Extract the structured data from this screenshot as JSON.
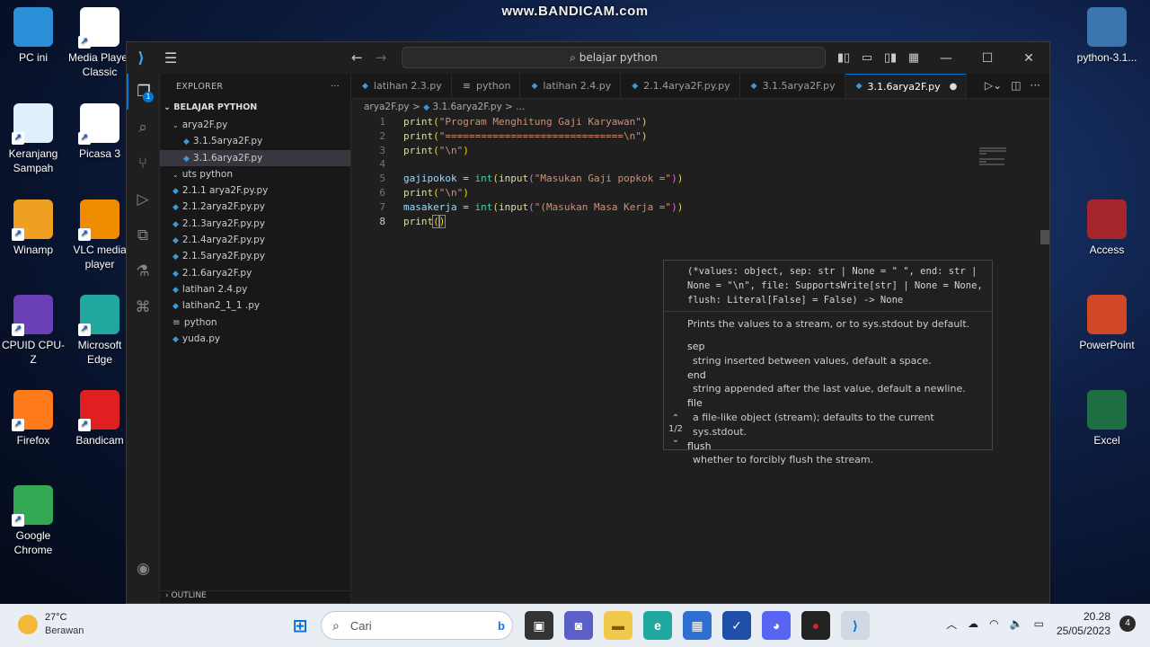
{
  "watermark": "www.BANDICAM.com",
  "desktop": {
    "left_icons": [
      {
        "label": "PC ini",
        "icon": "monitor-icon",
        "color": "#2b8fd8"
      },
      {
        "label": "Media Player Classic",
        "icon": "media-player-icon",
        "color": "#ffffff"
      },
      {
        "label": "Keranjang Sampah",
        "icon": "recycle-bin-icon",
        "color": "#e0f0ff"
      },
      {
        "label": "Picasa 3",
        "icon": "picasa-icon",
        "color": "#ffffff"
      },
      {
        "label": "Winamp",
        "icon": "winamp-icon",
        "color": "#f0a020"
      },
      {
        "label": "VLC media player",
        "icon": "vlc-icon",
        "color": "#f08c00"
      },
      {
        "label": "CPUID CPU-Z",
        "icon": "cpuz-icon",
        "color": "#6a3fb5"
      },
      {
        "label": "Microsoft Edge",
        "icon": "edge-icon",
        "color": "#1fa7a0"
      },
      {
        "label": "Firefox",
        "icon": "firefox-icon",
        "color": "#ff7a1a"
      },
      {
        "label": "Bandicam",
        "icon": "bandicam-icon",
        "color": "#e02020"
      },
      {
        "label": "Google Chrome",
        "icon": "chrome-icon",
        "color": "#34a853"
      }
    ],
    "right_icons": [
      {
        "label": "python-3.1...",
        "icon": "python-installer-icon",
        "color": "#3a75b0"
      },
      {
        "label": "Access",
        "icon": "access-icon",
        "color": "#a4262c"
      },
      {
        "label": "PowerPoint",
        "icon": "powerpoint-icon",
        "color": "#d24726"
      },
      {
        "label": "Excel",
        "icon": "excel-icon",
        "color": "#1d6f42"
      }
    ]
  },
  "vscode": {
    "command_center": "belajar python",
    "explorer_title": "EXPLORER",
    "explorer_more": "···",
    "workspace": "BELAJAR PYTHON",
    "tree": [
      {
        "label": "arya2F.py",
        "type": "folder",
        "indent": 1
      },
      {
        "label": "3.1.5arya2F.py",
        "type": "py",
        "indent": 2
      },
      {
        "label": "3.1.6arya2F.py",
        "type": "py",
        "indent": 2,
        "selected": true
      },
      {
        "label": "uts python",
        "type": "folder",
        "indent": 1
      },
      {
        "label": "2.1.1 arya2F.py.py",
        "type": "py",
        "indent": 1
      },
      {
        "label": "2.1.2arya2F.py.py",
        "type": "py",
        "indent": 1
      },
      {
        "label": "2.1.3arya2F.py.py",
        "type": "py",
        "indent": 1
      },
      {
        "label": "2.1.4arya2F.py.py",
        "type": "py",
        "indent": 1
      },
      {
        "label": "2.1.5arya2F.py.py",
        "type": "py",
        "indent": 1
      },
      {
        "label": "2.1.6arya2F.py",
        "type": "py",
        "indent": 1
      },
      {
        "label": "latihan 2.4.py",
        "type": "py",
        "indent": 1
      },
      {
        "label": "latihan2_1_1 .py",
        "type": "py",
        "indent": 1
      },
      {
        "label": "python",
        "type": "text",
        "indent": 1
      },
      {
        "label": "yuda.py",
        "type": "py",
        "indent": 1
      }
    ],
    "outline_label": "OUTLINE",
    "tabs": [
      {
        "label": "latihan 2.3.py",
        "type": "py"
      },
      {
        "label": "python",
        "type": "text"
      },
      {
        "label": "latihan 2.4.py",
        "type": "py"
      },
      {
        "label": "2.1.4arya2F.py.py",
        "type": "py"
      },
      {
        "label": "3.1.5arya2F.py",
        "type": "py"
      },
      {
        "label": "3.1.6arya2F.py",
        "type": "py",
        "active": true,
        "dirty": true
      }
    ],
    "breadcrumb": {
      "folder": "arya2F.py",
      "sep": ">",
      "file": "3.1.6arya2F.py",
      "rest": "> ..."
    },
    "code_lines": [
      {
        "n": "1",
        "parts": [
          [
            "fn",
            "print"
          ],
          [
            "br1",
            "("
          ],
          [
            "str",
            "\"Program Menghitung Gaji Karyawan\""
          ],
          [
            "br1",
            ")"
          ]
        ]
      },
      {
        "n": "2",
        "parts": [
          [
            "fn",
            "print"
          ],
          [
            "br1",
            "("
          ],
          [
            "str",
            "\"==============================\\n\""
          ],
          [
            "br1",
            ")"
          ]
        ]
      },
      {
        "n": "3",
        "parts": [
          [
            "fn",
            "print"
          ],
          [
            "br1",
            "("
          ],
          [
            "str",
            "\"\\n\""
          ],
          [
            "br1",
            ")"
          ]
        ]
      },
      {
        "n": "4",
        "parts": []
      },
      {
        "n": "5",
        "parts": [
          [
            "var",
            "gajipokok"
          ],
          [
            "op",
            " = "
          ],
          [
            "cls",
            "int"
          ],
          [
            "br1",
            "("
          ],
          [
            "fn",
            "input"
          ],
          [
            "br2",
            "("
          ],
          [
            "str",
            "\"Masukan Gaji popkok =\""
          ],
          [
            "br2",
            ")"
          ],
          [
            "br1",
            ")"
          ]
        ]
      },
      {
        "n": "6",
        "parts": [
          [
            "fn",
            "print"
          ],
          [
            "br1",
            "("
          ],
          [
            "str",
            "\"\\n\""
          ],
          [
            "br1",
            ")"
          ]
        ]
      },
      {
        "n": "7",
        "parts": [
          [
            "var",
            "masakerja"
          ],
          [
            "op",
            " = "
          ],
          [
            "cls",
            "int"
          ],
          [
            "br1",
            "("
          ],
          [
            "fn",
            "input"
          ],
          [
            "br2",
            "("
          ],
          [
            "str",
            "\"(Masukan Masa Kerja =\""
          ],
          [
            "br2",
            ")"
          ],
          [
            "br1",
            ")"
          ]
        ]
      },
      {
        "n": "8",
        "parts": [
          [
            "fn",
            "print"
          ],
          [
            "br1",
            "("
          ],
          [
            "br1",
            ")"
          ]
        ],
        "current": true
      }
    ],
    "hover": {
      "sig_lines": [
        "(*values: object, sep: str | None = \" \", end: str |",
        "None = \"\\n\", file: SupportsWrite[str] | None = None,",
        "flush: Literal[False] = False) -> None"
      ],
      "doc": "Prints the values to a stream, or to sys.stdout by default.",
      "params": [
        {
          "name": "sep",
          "desc": "string inserted between values, default a space."
        },
        {
          "name": "end",
          "desc": "string appended after the last value, default a newline."
        },
        {
          "name": "file",
          "desc": "a file-like object (stream); defaults to the current sys.stdout."
        },
        {
          "name": "flush",
          "desc": "whether to forcibly flush the stream."
        }
      ],
      "pager": "1/2"
    }
  },
  "taskbar": {
    "temp": "27°C",
    "weather": "Berawan",
    "search_placeholder": "Cari",
    "time": "20.28",
    "date": "25/05/2023",
    "notifications": "4"
  }
}
